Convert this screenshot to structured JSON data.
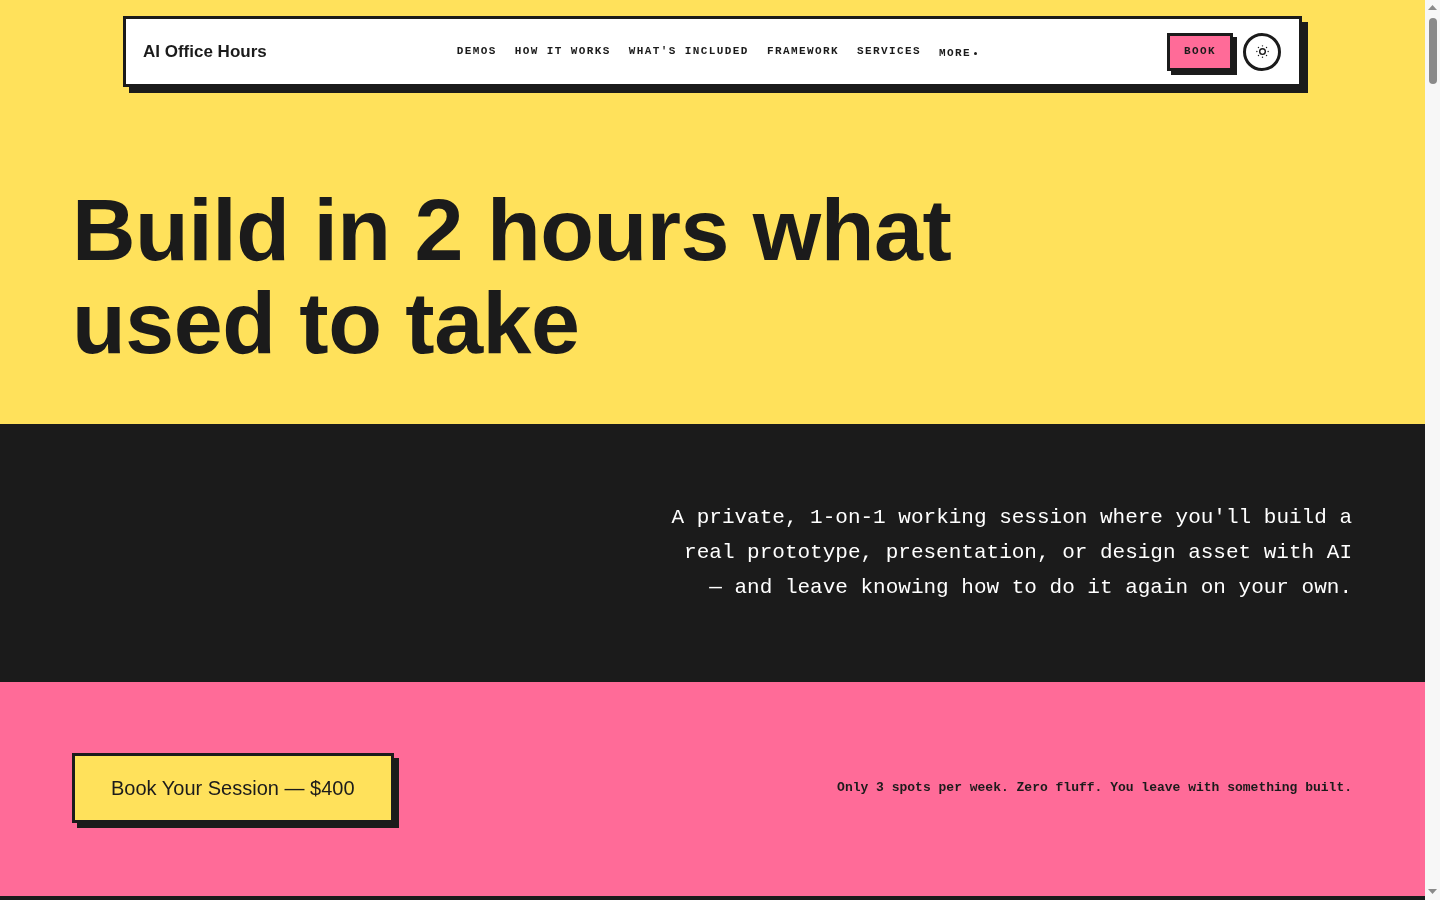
{
  "nav": {
    "brand": "AI Office Hours",
    "links": [
      {
        "label": "DEMOS",
        "kind": "link"
      },
      {
        "label": "HOW IT WORKS",
        "kind": "link"
      },
      {
        "label": "WHAT'S INCLUDED",
        "kind": "link"
      },
      {
        "label": "FRAMEWORK",
        "kind": "link"
      },
      {
        "label": "SERVICES",
        "kind": "link"
      },
      {
        "label": "MORE",
        "kind": "dropdown"
      }
    ],
    "cta": "BOOK"
  },
  "hero": {
    "heading": "Build in 2 hours what used to take"
  },
  "intro": {
    "text": "A private, 1-on-1 working session where you'll build a real prototype, presentation, or design asset with AI — and leave knowing how to do it again on your own."
  },
  "booking": {
    "button": "Book Your Session — $400",
    "note": "Only 3 spots per week. Zero fluff. You leave with something built."
  }
}
